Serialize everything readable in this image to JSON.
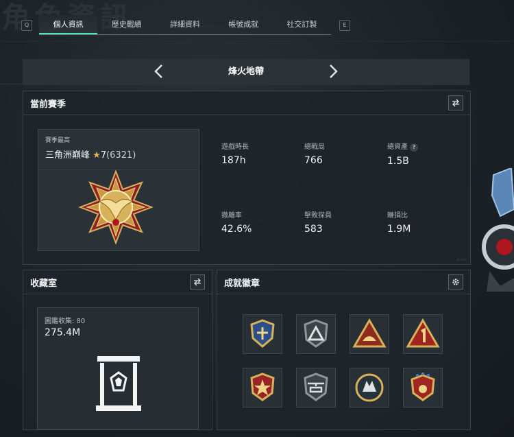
{
  "page": {
    "bg_title": "角色資訊"
  },
  "tabs": {
    "left_key": "Q",
    "right_key": "E",
    "items": [
      {
        "label": "個人資訊",
        "active": true
      },
      {
        "label": "歷史戰績",
        "active": false
      },
      {
        "label": "詳細資料",
        "active": false
      },
      {
        "label": "帳號成就",
        "active": false
      },
      {
        "label": "社交訂製",
        "active": false
      }
    ]
  },
  "map_selector": {
    "name": "烽火地帶"
  },
  "current_season": {
    "title": "當前賽季",
    "best_label": "賽季最高",
    "rank_name": "三角洲巔峰",
    "star": "★",
    "rank_level": "7",
    "rank_score": "(6321)",
    "stats": [
      {
        "label": "遊戲時長",
        "value": "187h"
      },
      {
        "label": "總戰局",
        "value": "766"
      },
      {
        "label": "總資產",
        "value": "1.5B",
        "help": "?"
      },
      {
        "label": "撤離率",
        "value": "42.6%"
      },
      {
        "label": "擊敗探員",
        "value": "583"
      },
      {
        "label": "賺損比",
        "value": "1.9M"
      }
    ]
  },
  "collection": {
    "title": "收藏室",
    "label": "圖鑑收集: 80",
    "value": "275.4M"
  },
  "achievements": {
    "title": "成就徽章",
    "badges": [
      "badge-1",
      "badge-2",
      "badge-3",
      "badge-4",
      "badge-5",
      "badge-6",
      "badge-7",
      "badge-8"
    ]
  },
  "colors": {
    "accent": "#4fe3c0",
    "gold": "#d8b25a",
    "crimson": "#8e1f24"
  }
}
